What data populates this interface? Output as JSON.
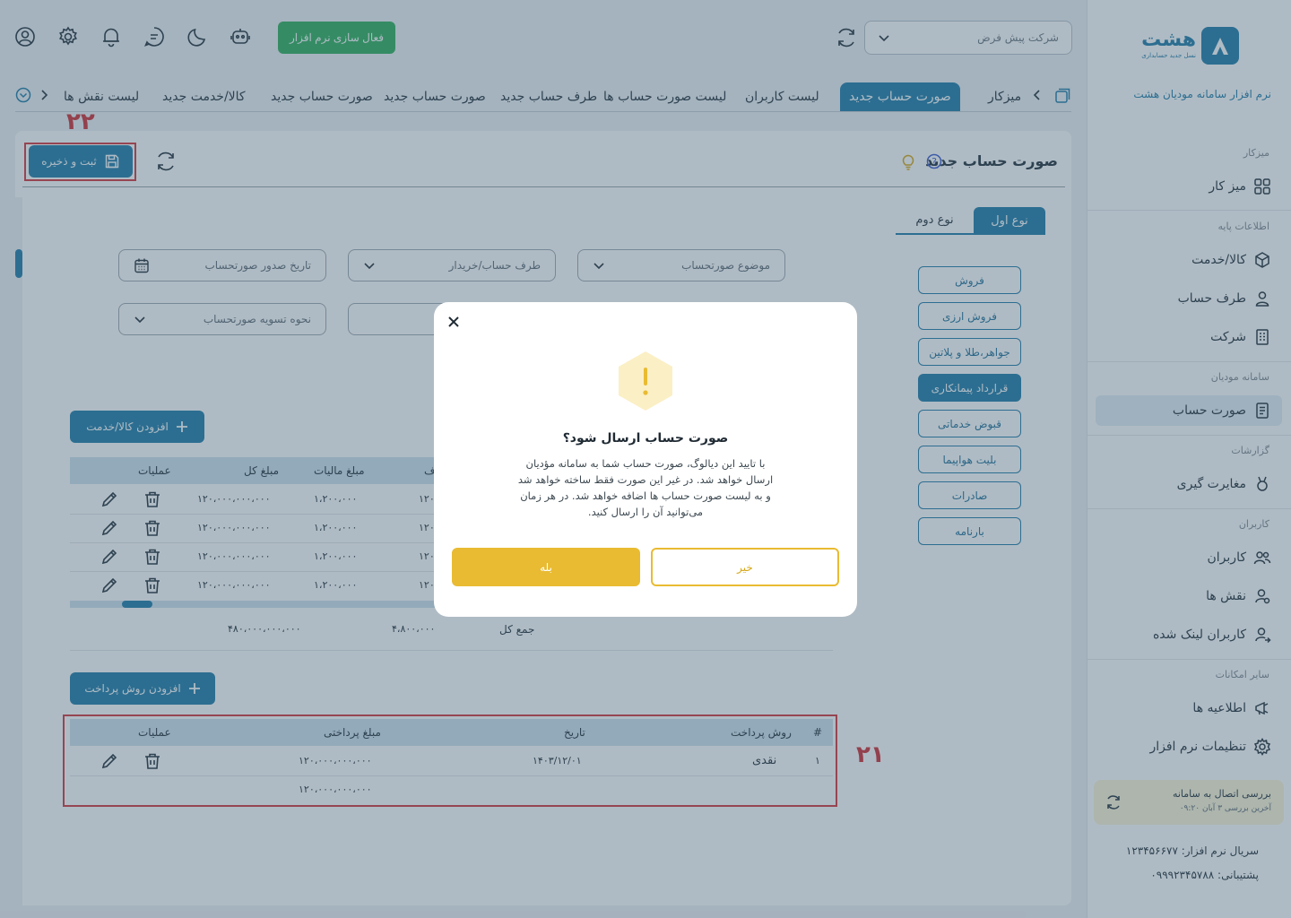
{
  "colors": {
    "primary": "#1e7aa8",
    "success": "#2eae5a",
    "warning": "#e9bb32",
    "annotation": "#d4353b"
  },
  "sidebar": {
    "logo_text": "هشت",
    "logo_sub": "نسل جدید حسابداری",
    "app_title": "نرم افزار سامانه مودیان هشت",
    "sections": [
      {
        "title": "میزکار",
        "items": [
          {
            "label": "میز کار",
            "icon": "grid-icon"
          }
        ]
      },
      {
        "title": "اطلاعات پایه",
        "items": [
          {
            "label": "کالا/خدمت",
            "icon": "box-icon"
          },
          {
            "label": "طرف حساب",
            "icon": "user-icon"
          },
          {
            "label": "شرکت",
            "icon": "building-icon"
          }
        ]
      },
      {
        "title": "سامانه مودیان",
        "items": [
          {
            "label": "صورت حساب",
            "icon": "invoice-icon",
            "active": true
          }
        ]
      },
      {
        "title": "گزارشات",
        "items": [
          {
            "label": "مغایرت گیری",
            "icon": "compare-icon"
          }
        ]
      },
      {
        "title": "کاربران",
        "items": [
          {
            "label": "کاربران",
            "icon": "users-icon"
          },
          {
            "label": "نقش ها",
            "icon": "user-role-icon"
          },
          {
            "label": "کاربران لینک شده",
            "icon": "user-link-icon"
          }
        ]
      },
      {
        "title": "سایر امکانات",
        "items": [
          {
            "label": "اطلاعیه ها",
            "icon": "announce-icon"
          },
          {
            "label": "تنظیمات نرم افزار",
            "icon": "gear-icon"
          }
        ]
      }
    ],
    "connection": {
      "title": "بررسی اتصال به سامانه",
      "subtitle": "آخرین بررسی ۳ آبان ۰۹:۲۰"
    },
    "serial": "سریال نرم افزار: ۱۲۳۴۵۶۶۷۷",
    "support": "پشتیبانی: ۰۹۹۹۲۳۴۵۷۸۸"
  },
  "header": {
    "activate_label": "فعال سازی نرم افزار",
    "company_select": "شرکت پیش فرض"
  },
  "tabs": [
    "میزکار",
    "صورت حساب جدید",
    "لیست کاربران",
    "لیست صورت حساب ها",
    "طرف حساب جدید",
    "صورت حساب جدید",
    "صورت حساب جدید",
    "کالا/خدمت جدید",
    "لیست نقش ها"
  ],
  "page": {
    "title": "صورت حساب جدید",
    "save_label": "ثبت و ذخیره",
    "type_tabs": [
      "نوع اول",
      "نوع دوم"
    ],
    "fields": {
      "subject": "موضوع صورتحساب",
      "party": "طرف حساب/خریدار",
      "issue_date": "تاریخ صدور صورتحساب",
      "settlement": "نحوه تسویه صورتحساب"
    },
    "invoice_types": [
      "فروش",
      "فروش ارزی",
      "جواهر،طلا و پلاتین",
      "قرارداد پیمانکاری",
      "قبوض خدماتی",
      "بلیت هواپیما",
      "صادرات",
      "بارنامه"
    ],
    "add_item_label": "افزودن کالا/خدمت",
    "items_table": {
      "headers": [
        "عملیات",
        "مبلغ کل",
        "مبلغ مالیات",
        "ف"
      ],
      "rows": [
        {
          "total": "۱۲۰،۰۰۰،۰۰۰،۰۰۰",
          "tax": "۱،۲۰۰،۰۰۰",
          "partial": "۱۲۰"
        },
        {
          "total": "۱۲۰،۰۰۰،۰۰۰،۰۰۰",
          "tax": "۱،۲۰۰،۰۰۰",
          "partial": "۱۲۰"
        },
        {
          "total": "۱۲۰،۰۰۰،۰۰۰،۰۰۰",
          "tax": "۱،۲۰۰،۰۰۰",
          "partial": "۱۲۰"
        },
        {
          "total": "۱۲۰،۰۰۰،۰۰۰،۰۰۰",
          "tax": "۱،۲۰۰،۰۰۰",
          "partial": "۱۲۰"
        }
      ],
      "sum_label": "جمع کل",
      "sum_total": "۴۸۰،۰۰۰،۰۰۰،۰۰۰",
      "sum_tax": "۴،۸۰۰،۰۰۰"
    },
    "add_payment_label": "افزودن روش پرداخت",
    "payments_table": {
      "headers": [
        "#",
        "روش پرداخت",
        "تاریخ",
        "مبلغ پرداختی",
        "عملیات"
      ],
      "rows": [
        {
          "index": "۱",
          "method": "نقدی",
          "date": "۱۴۰۳/۱۲/۰۱",
          "amount": "۱۲۰،۰۰۰،۰۰۰،۰۰۰"
        }
      ],
      "total": "۱۲۰،۰۰۰،۰۰۰،۰۰۰"
    }
  },
  "annotations": {
    "save": "۲۲",
    "payments": "۲۱"
  },
  "modal": {
    "title": "صورت حساب ارسال شود؟",
    "body_lines": [
      "با تایید این دیالوگ، صورت حساب شما به سامانه مؤدیان",
      "ارسال خواهد شد. در غیر این صورت فقط ساخته خواهد شد",
      "و به لیست صورت حساب ها اضافه خواهد شد. در هر زمان",
      "می‌توانید آن را ارسال کنید."
    ],
    "yes_label": "بله",
    "no_label": "خیر",
    "icon": "warning-icon"
  }
}
